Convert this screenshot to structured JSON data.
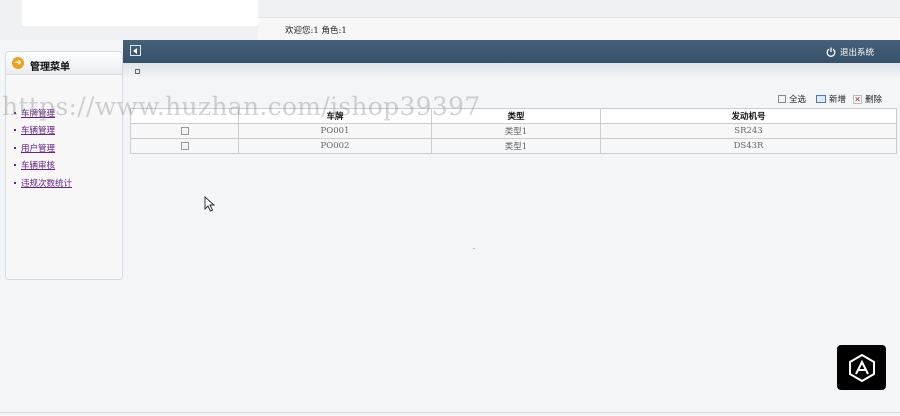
{
  "header": {
    "welcome_text": "欢迎您:1 角色:1",
    "logout_label": "退出系统"
  },
  "sidebar": {
    "title": "管理菜单",
    "items": [
      {
        "label": "车牌管理"
      },
      {
        "label": "车辆管理"
      },
      {
        "label": "用户管理"
      },
      {
        "label": "车辆审核"
      },
      {
        "label": "违规次数统计"
      }
    ]
  },
  "toolbar": {
    "select_all_label": "全选",
    "add_label": "新增",
    "delete_label": "删除"
  },
  "table": {
    "columns": [
      "",
      "车牌",
      "类型",
      "发动机号"
    ],
    "rows": [
      {
        "plate": "PO001",
        "type": "类型1",
        "engine": "SR243"
      },
      {
        "plate": "PO002",
        "type": "类型1",
        "engine": "DS43R"
      }
    ]
  },
  "watermark": "https://www.huzhan.com/ishop39397",
  "icons": [
    "collapse-arrow-icon",
    "power-icon",
    "arrow-right-circle-icon",
    "checkbox-icon",
    "add-icon",
    "delete-icon",
    "mouse-cursor-icon",
    "logo-badge-icon"
  ],
  "colors": {
    "header_bar": "#3d566d",
    "menu_link": "#662288",
    "menu_icon": "#f0a020"
  }
}
